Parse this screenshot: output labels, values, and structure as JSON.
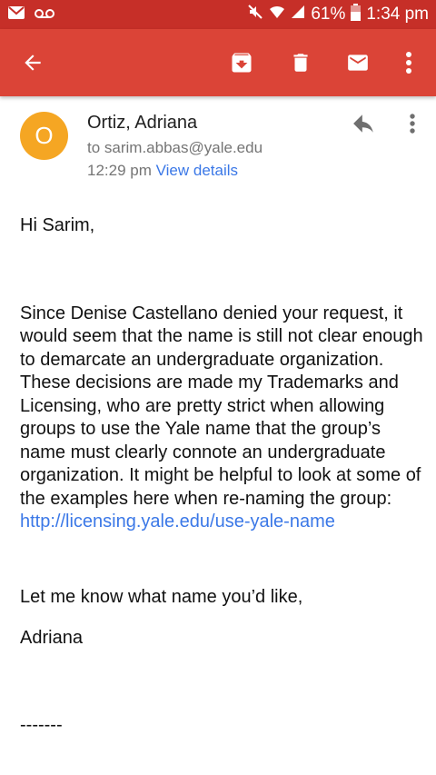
{
  "status_bar": {
    "battery_text": "61%",
    "time": "1:34 pm",
    "icons": [
      "gmail-icon",
      "voicemail-icon",
      "mute-icon",
      "wifi-icon",
      "signal-icon",
      "battery-icon"
    ]
  },
  "toolbar": {
    "icons": [
      "back-arrow-icon",
      "archive-icon",
      "delete-icon",
      "mark-unread-icon",
      "more-vert-icon"
    ]
  },
  "message": {
    "avatar_letter": "O",
    "sender": "Ortiz, Adriana",
    "recipient": "to sarim.abbas@yale.edu",
    "time": "12:29 pm",
    "details_link": "View details",
    "greeting": "Hi Sarim,",
    "paragraph": "Since Denise Castellano denied your request, it would seem that the name is still not clear enough to demarcate an undergraduate organization. These decisions are made my Trademarks and Licensing, who are pretty strict when allowing groups to use the Yale name that the group’s name must clearly connote an undergraduate organization. It might be helpful to look at some of the examples here when re-naming the group:",
    "link": "http://licensing.yale.edu/use-yale-name",
    "closing": "Let me know what name you’d like,",
    "signature": "Adriana",
    "separator": "-------"
  },
  "colors": {
    "status_bar": "#c62f28",
    "app_bar": "#db4437",
    "avatar": "#f5a623",
    "link": "#3b78e7"
  }
}
